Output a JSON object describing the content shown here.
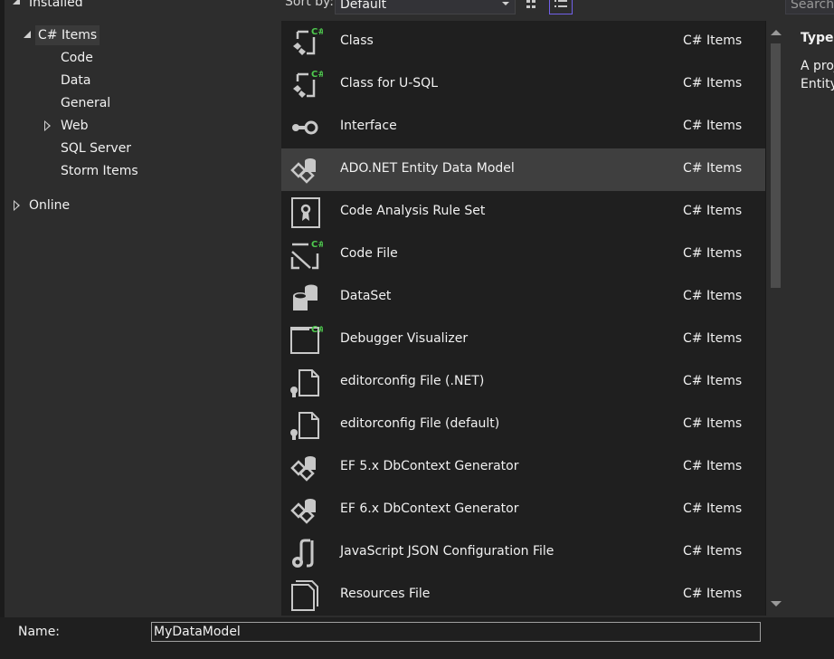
{
  "tree": {
    "installed_label": "Installed",
    "csharp_items_label": "C# Items",
    "children": [
      "Code",
      "Data",
      "General",
      "Web",
      "SQL Server",
      "Storm Items"
    ],
    "online_label": "Online"
  },
  "toolbar": {
    "sort_label": "Sort by:",
    "sort_value": "Default",
    "search_placeholder": "Search"
  },
  "items": [
    {
      "name": "Class",
      "type": "C# Items",
      "icon": "class-icon"
    },
    {
      "name": "Class for U-SQL",
      "type": "C# Items",
      "icon": "class-icon"
    },
    {
      "name": "Interface",
      "type": "C# Items",
      "icon": "interface-icon"
    },
    {
      "name": "ADO.NET Entity Data Model",
      "type": "C# Items",
      "icon": "entity-model-icon",
      "selected": true
    },
    {
      "name": "Code Analysis Rule Set",
      "type": "C# Items",
      "icon": "rule-set-icon"
    },
    {
      "name": "Code File",
      "type": "C# Items",
      "icon": "code-file-icon"
    },
    {
      "name": "DataSet",
      "type": "C# Items",
      "icon": "dataset-icon"
    },
    {
      "name": "Debugger Visualizer",
      "type": "C# Items",
      "icon": "debugger-visualizer-icon"
    },
    {
      "name": "editorconfig File (.NET)",
      "type": "C# Items",
      "icon": "editorconfig-icon"
    },
    {
      "name": "editorconfig File (default)",
      "type": "C# Items",
      "icon": "editorconfig-icon"
    },
    {
      "name": "EF 5.x DbContext Generator",
      "type": "C# Items",
      "icon": "entity-model-icon"
    },
    {
      "name": "EF 6.x DbContext Generator",
      "type": "C# Items",
      "icon": "entity-model-icon"
    },
    {
      "name": "JavaScript JSON Configuration File",
      "type": "C# Items",
      "icon": "json-config-icon"
    },
    {
      "name": "Resources File",
      "type": "C# Items",
      "icon": "resources-file-icon"
    }
  ],
  "details": {
    "type_label": "Type:",
    "description": "A proj Entity"
  },
  "name_field": {
    "label": "Name:",
    "value": "MyDataModel"
  },
  "colors": {
    "csharp_badge": "#4ec94e",
    "active_view_border": "#7160e8",
    "selection_bg": "#3f3f3f"
  }
}
